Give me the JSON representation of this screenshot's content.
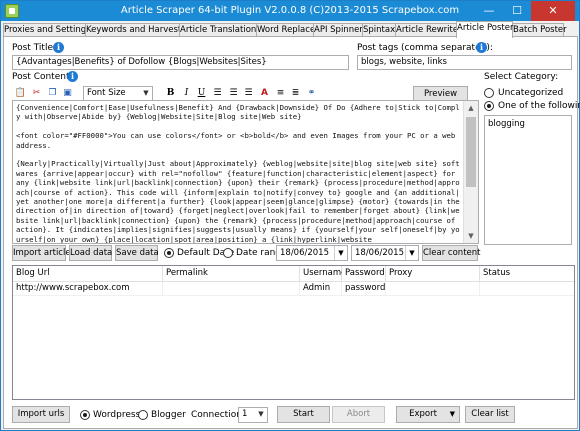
{
  "window": {
    "title": "Article Scraper 64-bit Plugin V2.0.0.8 (C)2013-2015 Scrapebox.com",
    "minimize": "—",
    "maximize": "☐",
    "close": "✕"
  },
  "tabs": [
    {
      "label": "Proxies and Settings",
      "active": false
    },
    {
      "label": "Keywords and Harvester",
      "active": false
    },
    {
      "label": "Article Translation",
      "active": false
    },
    {
      "label": "Word Replace",
      "active": false
    },
    {
      "label": "API Spinner",
      "active": false
    },
    {
      "label": "Spintax",
      "active": false
    },
    {
      "label": "Article Rewriter",
      "active": false
    },
    {
      "label": "Article Poster",
      "active": true
    },
    {
      "label": "Batch Poster",
      "active": false
    }
  ],
  "post_title": {
    "label": "Post Title:",
    "value": "{Advantages|Benefits} of Dofollow {Blogs|Websites|Sites}"
  },
  "post_tags": {
    "label": "Post tags (comma separated):",
    "value": "blogs, website, links"
  },
  "post_content": {
    "label": "Post Content:",
    "font_size": "Font Size",
    "preview_label": "Preview",
    "text": "{Convenience|Comfort|Ease|Usefulness|Benefit} And {Drawback|Downside} Of Do {Adhere to|Stick to|Comply with|Observe|Abide by} {Weblog|Website|Site|Blog site|Web site}\n\n<font color=\"#FF0000\">You can use colors</font> or <b>bold</b> and even Images from your PC or a web address.\n\n{Nearly|Practically|Virtually|Just about|Approximately} {weblog|website|site|blog site|web site} softwares {arrive|appear|occur} with rel=\"nofollow\" {feature|function|characteristic|element|aspect} for any {link|website link|url|backlink|connection} {upon} their {remark} {process|procedure|method|approach|course of action}. This code will {inform|explain to|notify|convey to} google and {an additional|yet another|one more|a different|a further} {look|appear|seem|glance|glimpse} {motor} {towards|in the direction of|in direction of|toward} {forget|neglect|overlook|fail to remember|forget about} {link|website link|url|backlink|connection} {upon} the {remark} {process|procedure|method|approach|course of action}. It {indicates|implies|signifies|suggests|usually means} if {yourself|your self|oneself|by yourself|on your own} {place|location|spot|area|position} a {link|hyperlink|website"
  },
  "category": {
    "label": "Select Category:",
    "options": [
      {
        "label": "Uncategorized",
        "selected": false
      },
      {
        "label": "One of the following",
        "selected": true
      }
    ],
    "list_value": "blogging"
  },
  "actions": {
    "import_article": "Import article",
    "load_data": "Load data",
    "save_data": "Save data",
    "default_date": "Default Date",
    "date_range": "Date range",
    "date_from": "18/06/2015",
    "date_to": "18/06/2015",
    "clear_content": "Clear content",
    "date_mode": "default"
  },
  "grid": {
    "columns": [
      "Blog Url",
      "Permalink",
      "Username",
      "Password",
      "Proxy",
      "Status"
    ],
    "rows": [
      [
        "http://www.scrapebox.com",
        "",
        "Admin",
        "password",
        "",
        ""
      ]
    ]
  },
  "footer": {
    "import_urls": "Import urls",
    "wordpress": "Wordpress",
    "blogger": "Blogger",
    "platform": "wordpress",
    "connections_label": "Connections:",
    "connections": "1",
    "start": "Start",
    "abort": "Abort",
    "export": "Export",
    "clear_list": "Clear list"
  },
  "colors": {
    "titlebar": "#1c8bd6",
    "info_icon": "#1e7ad4",
    "close_button": "#c7372f"
  }
}
